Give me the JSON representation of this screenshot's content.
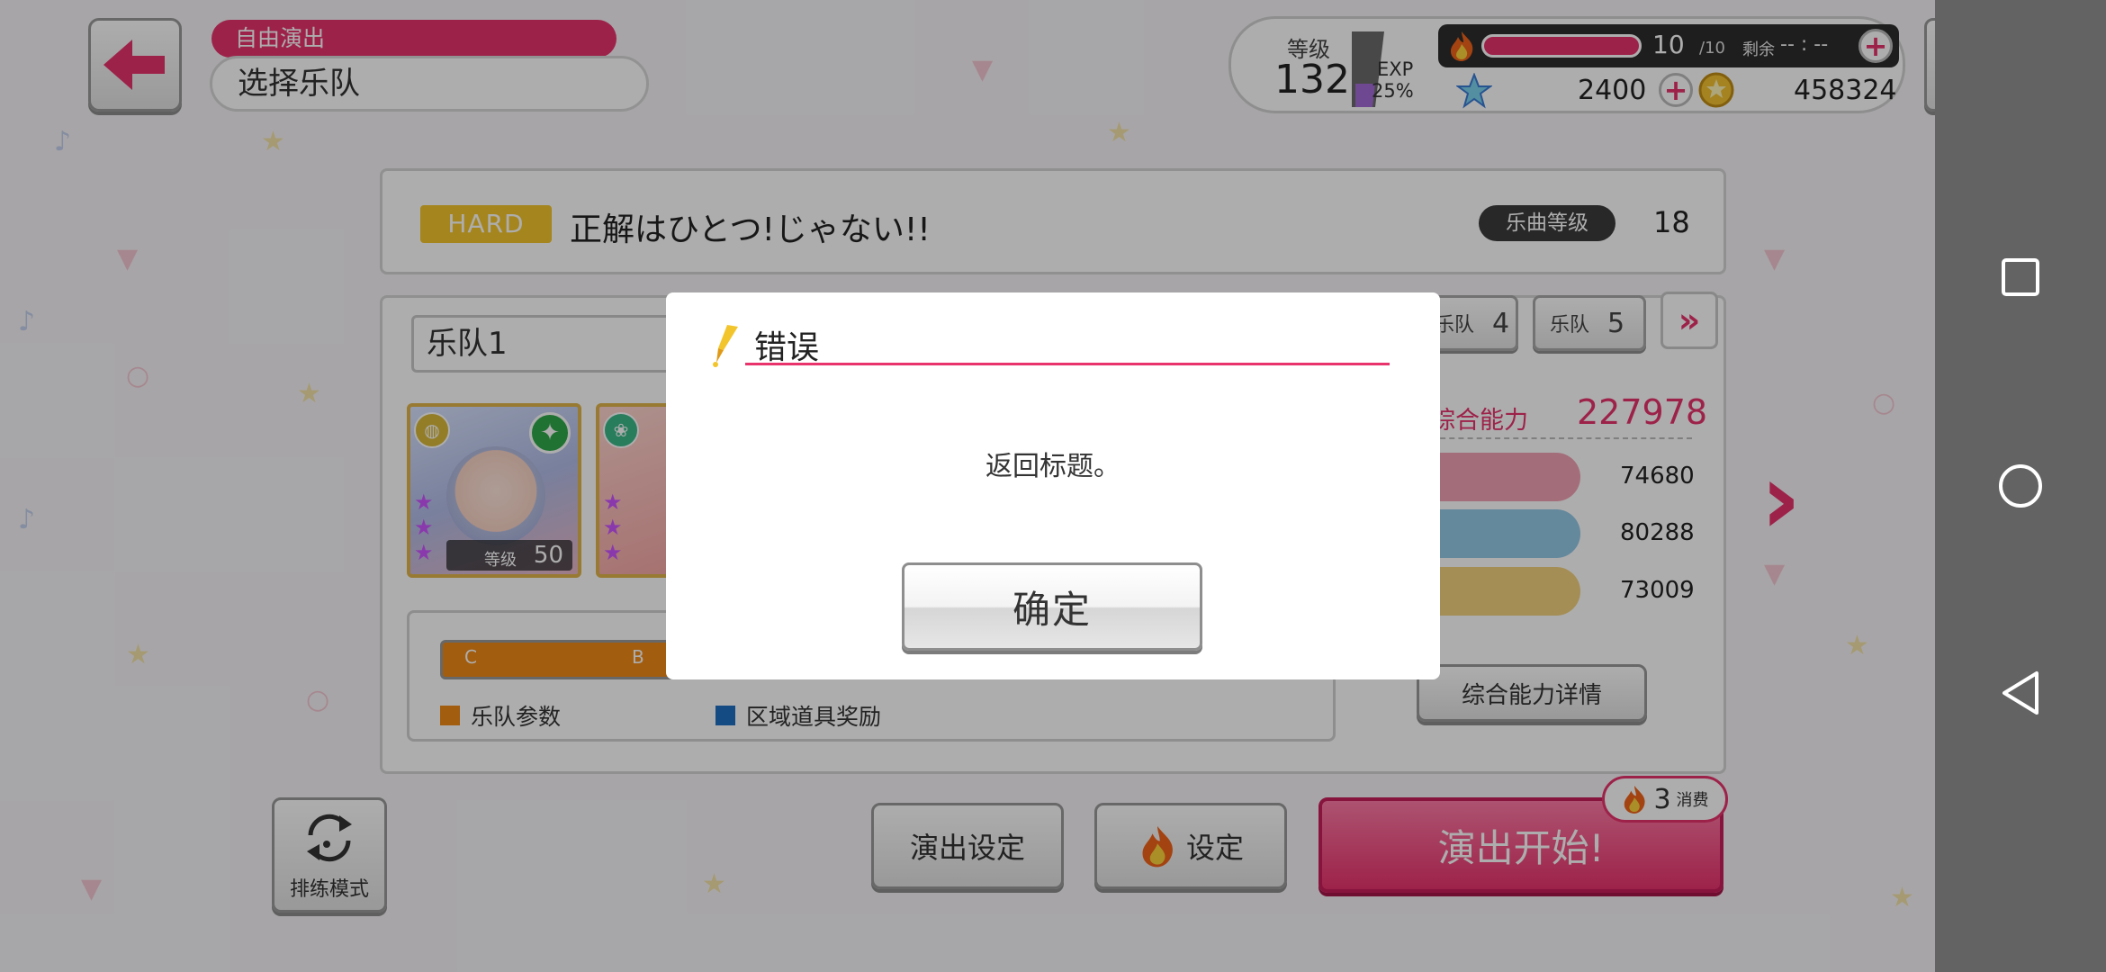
{
  "header": {
    "mode_tag": "自由演出",
    "mode_subtitle": "选择乐队"
  },
  "status": {
    "level_label": "等级",
    "level": "132",
    "exp_label": "EXP",
    "exp_percent": "25%",
    "stamina_value": "10",
    "stamina_max": "/10",
    "remain_label": "剩余",
    "remain_time": "-- : --",
    "star_gems": "2400",
    "coins": "458324"
  },
  "song": {
    "difficulty": "HARD",
    "title": "正解はひとつ!じゃない!!",
    "level_label": "乐曲等级",
    "level": "18"
  },
  "band": {
    "current_name": "乐队1",
    "tabs": [
      {
        "label": "乐队",
        "number": "4"
      },
      {
        "label": "乐队",
        "number": "5"
      }
    ],
    "cards": [
      {
        "level_label": "等级",
        "level": "50"
      },
      {
        "level_label": "",
        "level": ""
      }
    ],
    "param_ticks": [
      "C",
      "B"
    ],
    "legend": [
      "乐队参数",
      "区域道具奖励"
    ],
    "power_label": "综合能力",
    "power_value": "227978",
    "stats": [
      "74680",
      "80288",
      "73009"
    ],
    "power_detail": "综合能力详情"
  },
  "footer": {
    "rehearsal_label": "排练模式",
    "performance_settings": "演出设定",
    "settings": "设定",
    "start": "演出开始!",
    "cost_value": "3",
    "cost_unit": "消费"
  },
  "dialog": {
    "title": "错误",
    "message": "返回标题。",
    "ok": "确定"
  },
  "colors": {
    "accent": "#e8336d",
    "hard": "#f3c52c",
    "band_param": "#ef8a17",
    "area_item": "#1e6fc1",
    "navbar": "#636363"
  },
  "icons": {
    "back": "arrow-left-icon",
    "menu": "hamburger-icon",
    "stamina": "fire-icon",
    "star": "star-icon",
    "coin": "coin-icon",
    "dialog": "pen-icon"
  }
}
